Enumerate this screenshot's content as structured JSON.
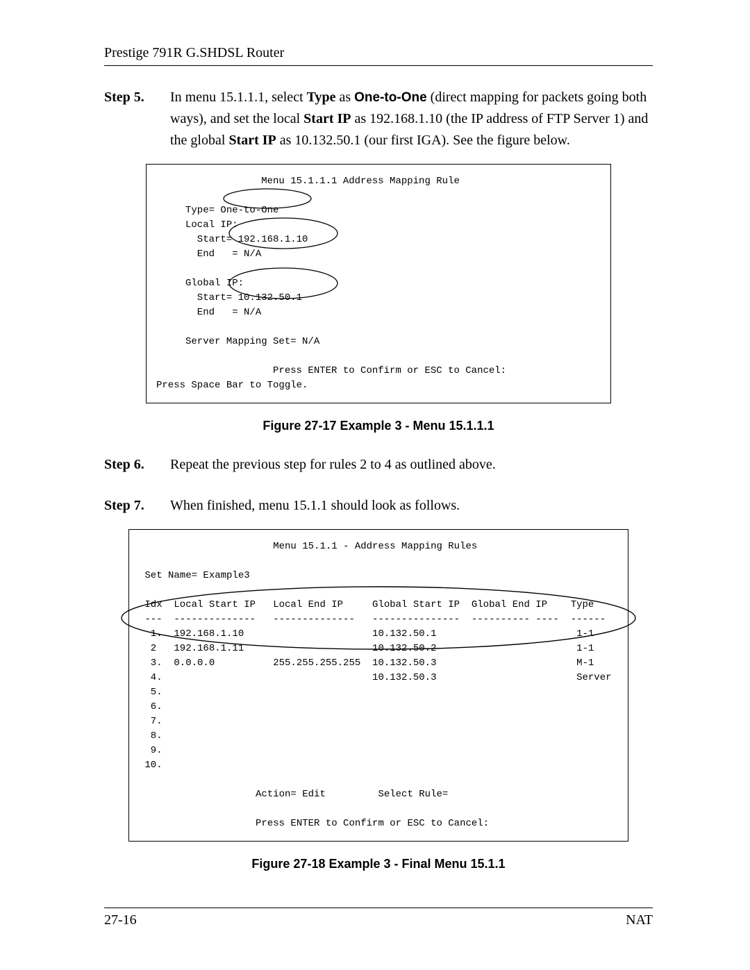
{
  "header": {
    "title": "Prestige 791R G.SHDSL Router"
  },
  "step5": {
    "label": "Step 5.",
    "parts": {
      "p1": "In menu 15.1.1.1, select ",
      "p2_bold": "Type",
      "p3": " as ",
      "p4_sans": "One-to-One",
      "p5": " (direct mapping for packets going both ways), and set the local ",
      "p6_bold": "Start IP",
      "p7": " as 192.168.1.10 (the IP address of FTP Server 1) and the global ",
      "p8_bold": "Start IP",
      "p9": " as 10.132.50.1 (our first IGA). See the figure below."
    }
  },
  "term1": {
    "title": "                  Menu 15.1.1.1 Address Mapping Rule",
    "type_lhs": "     Type",
    "type_rhs": "= One-to-One",
    "local_hdr": "     Local IP:",
    "local_start_l": "       Start=",
    "local_start_r": " 192.168.1.10",
    "local_end": "       End   = N/A",
    "global_hdr": "     Global IP:",
    "global_start_l": "       Start=",
    "global_start_r": " 10.132.50.1",
    "global_end": "       End   = N/A",
    "server": "     Server Mapping Set= N/A",
    "confirm": "                    Press ENTER to Confirm or ESC to Cancel:",
    "toggle": "Press Space Bar to Toggle."
  },
  "caption1": "Figure 27-17 Example 3 - Menu 15.1.1.1",
  "step6": {
    "label": "Step 6.",
    "text": "Repeat the previous step for rules 2 to 4 as outlined above."
  },
  "step7": {
    "label": "Step 7.",
    "text": "When finished, menu 15.1.1 should look as follows."
  },
  "term2": {
    "title": "                       Menu 15.1.1 - Address Mapping Rules",
    "setname": " Set Name= Example3",
    "hdr": " Idx  Local Start IP   Local End IP     Global Start IP  Global End IP    Type",
    "sep": " ---  --------------   --------------   ---------------  ---------- ----  ------",
    "r1": "  1.  192.168.1.10                      10.132.50.1                        1-1",
    "r2": "  2   192.168.1.11                      10.132.50.2                        1-1",
    "r3": "  3.  0.0.0.0          255.255.255.255  10.132.50.3                        M-1",
    "r4": "  4.                                    10.132.50.3                        Server",
    "r5": "  5.",
    "r6": "  6.",
    "r7": "  7.",
    "r8": "  8.",
    "r9": "  9.",
    "r10": " 10.",
    "action": "                    Action= Edit         Select Rule=",
    "confirm": "                    Press ENTER to Confirm or ESC to Cancel:"
  },
  "caption2": "Figure 27-18 Example 3 - Final Menu 15.1.1",
  "footer": {
    "left": "27-16",
    "right": "NAT"
  }
}
